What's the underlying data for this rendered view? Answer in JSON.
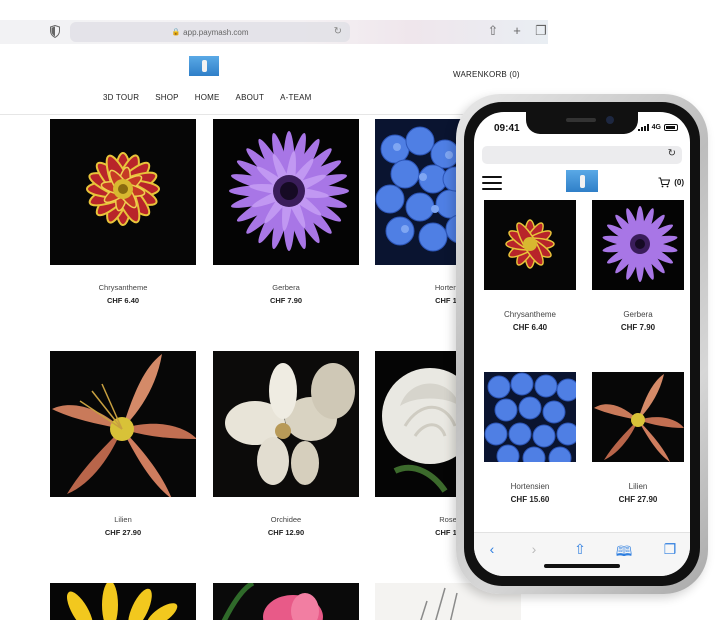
{
  "browser": {
    "url": "app.paymash.com",
    "icons": [
      "shield-icon",
      "lock-icon",
      "reload-icon",
      "share-icon",
      "new-tab-icon",
      "tabs-icon"
    ]
  },
  "site": {
    "cart_label": "WARENKORB (0)",
    "nav": [
      "3D TOUR",
      "SHOP",
      "HOME",
      "ABOUT",
      "A-TEAM"
    ]
  },
  "products": [
    {
      "name": "Chrysantheme",
      "price": "CHF 6.40"
    },
    {
      "name": "Gerbera",
      "price": "CHF 7.90"
    },
    {
      "name": "Hortens",
      "price": "CHF 15"
    },
    {
      "name": "Lilien",
      "price": "CHF 27.90"
    },
    {
      "name": "Orchidee",
      "price": "CHF 12.90"
    },
    {
      "name": "Rose",
      "price": "CHF 19"
    }
  ],
  "phone": {
    "time": "09:41",
    "network": "4G",
    "cart_count": "(0)",
    "products": [
      {
        "name": "Chrysantheme",
        "price": "CHF 6.40"
      },
      {
        "name": "Gerbera",
        "price": "CHF 7.90"
      },
      {
        "name": "Hortensien",
        "price": "CHF 15.60"
      },
      {
        "name": "Lilien",
        "price": "CHF 27.90"
      }
    ]
  },
  "colors": {
    "accent": "#2f7fe0",
    "logo": "#2f7fc8"
  }
}
